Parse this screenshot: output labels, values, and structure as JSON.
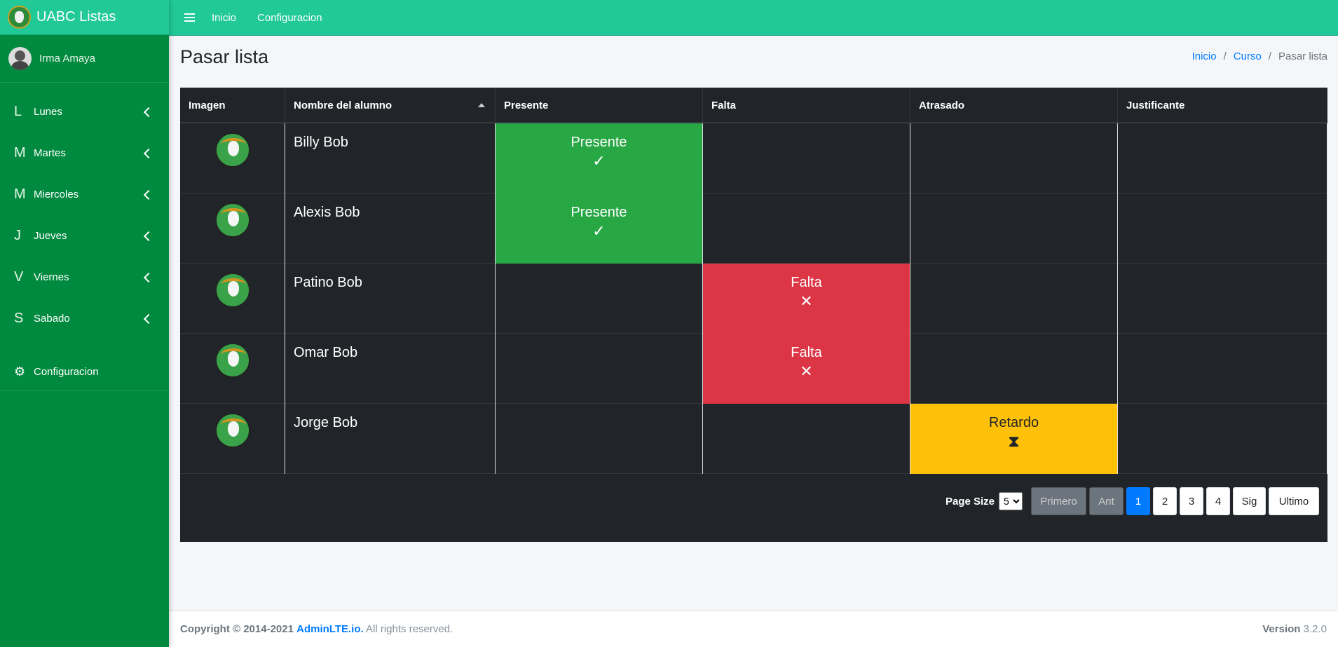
{
  "brand": {
    "title": "UABC Listas"
  },
  "user": {
    "name": "Irma Amaya"
  },
  "sidebar": {
    "items": [
      {
        "letter": "L",
        "label": "Lunes"
      },
      {
        "letter": "M",
        "label": "Martes"
      },
      {
        "letter": "M",
        "label": "Miercoles"
      },
      {
        "letter": "J",
        "label": "Jueves"
      },
      {
        "letter": "V",
        "label": "Viernes"
      },
      {
        "letter": "S",
        "label": "Sabado"
      }
    ],
    "config_label": "Configuracion",
    "config_icon": "gear-icon"
  },
  "topbar": {
    "home": "Inicio",
    "config": "Configuracion"
  },
  "page": {
    "title": "Pasar lista"
  },
  "breadcrumb": {
    "home": "Inicio",
    "course": "Curso",
    "current": "Pasar lista"
  },
  "table": {
    "headers": [
      "Imagen",
      "Nombre del alumno",
      "Presente",
      "Falta",
      "Atrasado",
      "Justificante"
    ],
    "rows": [
      {
        "name": "Billy Bob"
      },
      {
        "name": "Alexis Bob"
      },
      {
        "name": "Patino Bob"
      },
      {
        "name": "Omar Bob"
      },
      {
        "name": "Jorge Bob"
      }
    ],
    "status_labels": {
      "present": "Presente",
      "absent": "Falta",
      "late": "Retardo"
    },
    "status_icons": {
      "present": "✓",
      "absent": "✕",
      "late": "⧗"
    }
  },
  "pager": {
    "label": "Page Size",
    "page_size": "5",
    "first": "Primero",
    "prev": "Ant",
    "pages": [
      "1",
      "2",
      "3",
      "4"
    ],
    "next": "Sig",
    "last": "Ultimo"
  },
  "footer": {
    "copyright": "Copyright © 2014-2021",
    "link": "AdminLTE.io.",
    "rights": "All rights reserved.",
    "version_label": "Version",
    "version": "3.2.0"
  },
  "colors": {
    "sidebar": "#008a3f",
    "topbar": "#20c997",
    "present": "#28a745",
    "absent": "#dc3545",
    "late": "#ffc107",
    "table_bg": "#212529"
  }
}
